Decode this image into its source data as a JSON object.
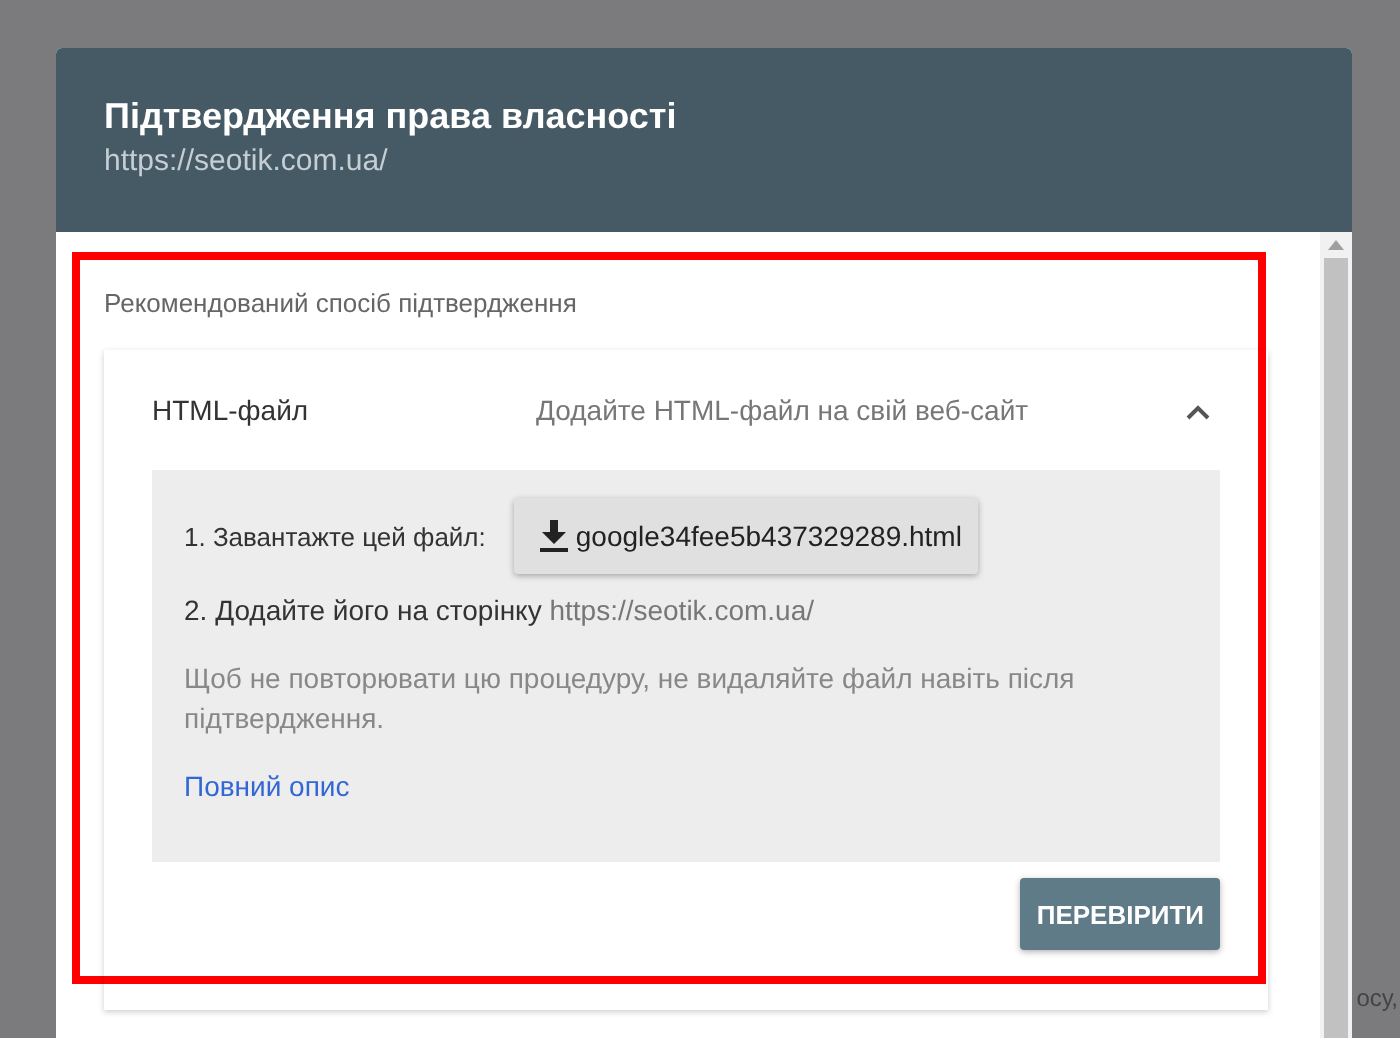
{
  "dialog": {
    "title": "Підтвердження права власності",
    "subtitle": "https://seotik.com.ua/"
  },
  "section_label": "Рекомендований спосіб підтвердження",
  "method": {
    "name": "HTML-файл",
    "description": "Додайте HTML-файл на свій веб-сайт",
    "expanded": true,
    "step1_label": "1. Завантажте цей файл:",
    "download_file": "google34fee5b437329289.html",
    "step2_label": "2. Додайте його на сторінку",
    "step2_url": "https://seotik.com.ua/",
    "note": "Щоб не повторювати цю процедуру, не видаляйте файл навіть після підтвердження.",
    "link": "Повний опис",
    "verify_button": "ПЕРЕВІРИТИ"
  },
  "background_text": "осу,"
}
